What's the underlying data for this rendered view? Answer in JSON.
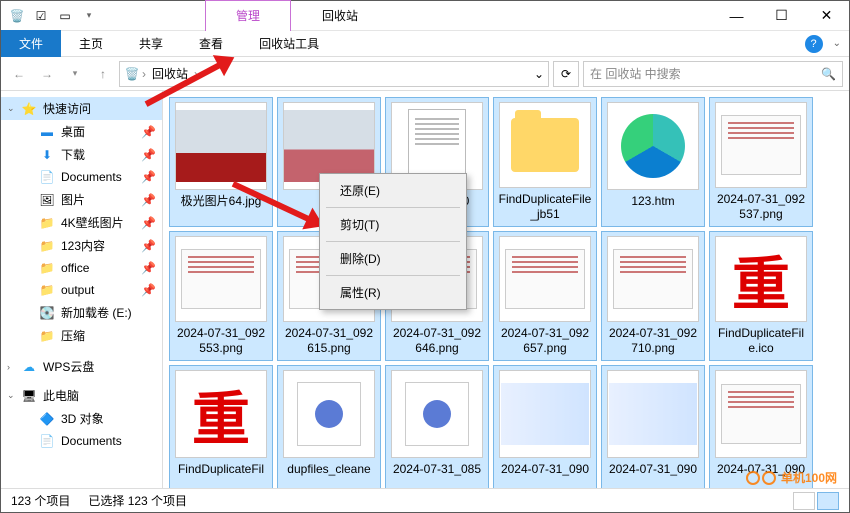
{
  "window": {
    "title_tab1": "管理",
    "title_tab2": "回收站"
  },
  "ribbon": {
    "file": "文件",
    "home": "主页",
    "share": "共享",
    "view": "查看",
    "tools": "回收站工具"
  },
  "address": {
    "root": "回收站"
  },
  "search": {
    "placeholder": "在 回收站 中搜索"
  },
  "sidebar": {
    "quick": "快速访问",
    "desktop": "桌面",
    "downloads": "下载",
    "documents": "Documents",
    "pictures": "图片",
    "wallpaper": "4K壁纸图片",
    "folder123": "123内容",
    "office": "office",
    "output": "output",
    "newvol": "新加载卷 (E:)",
    "compressed": "压缩",
    "wps": "WPS云盘",
    "thispc": "此电脑",
    "obj3d": "3D 对象",
    "docs2": "Documents"
  },
  "ctx": {
    "restore": "还原(E)",
    "cut": "剪切(T)",
    "delete": "删除(D)",
    "props": "属性(R)"
  },
  "items": [
    {
      "label": "极光图片64.jpg",
      "kind": "photo"
    },
    {
      "label": "",
      "kind": "photo2"
    },
    {
      "label": "uplicar_v2.0",
      "kind": "doc"
    },
    {
      "label": "FindDuplicateFile_jb51",
      "kind": "folder"
    },
    {
      "label": "123.htm",
      "kind": "edge"
    },
    {
      "label": "2024-07-31_092537.png",
      "kind": "png"
    },
    {
      "label": "2024-07-31_092553.png",
      "kind": "png"
    },
    {
      "label": "2024-07-31_092615.png",
      "kind": "png"
    },
    {
      "label": "2024-07-31_092646.png",
      "kind": "png"
    },
    {
      "label": "2024-07-31_092657.png",
      "kind": "png"
    },
    {
      "label": "2024-07-31_092710.png",
      "kind": "png"
    },
    {
      "label": "FindDuplicateFile.ico",
      "kind": "redchar"
    },
    {
      "label": "FindDuplicateFil",
      "kind": "redchar"
    },
    {
      "label": "dupfiles_cleane",
      "kind": "app"
    },
    {
      "label": "2024-07-31_085",
      "kind": "app"
    },
    {
      "label": "2024-07-31_090",
      "kind": "grad"
    },
    {
      "label": "2024-07-31_090",
      "kind": "grad"
    },
    {
      "label": "2024-07-31_090",
      "kind": "png"
    }
  ],
  "status": {
    "count": "123 个项目",
    "selected": "已选择 123 个项目"
  },
  "watermark": "单机100网"
}
